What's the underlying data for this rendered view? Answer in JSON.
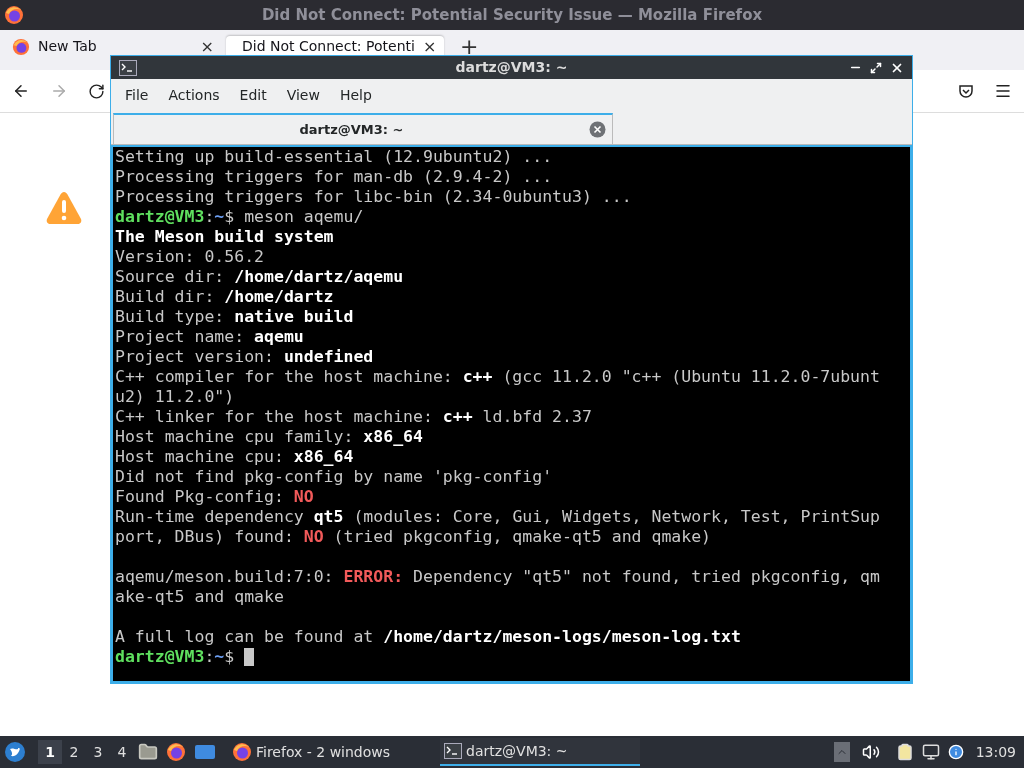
{
  "firefox": {
    "title": "Did Not Connect: Potential Security Issue — Mozilla Firefox",
    "tabs": [
      {
        "label": "New Tab",
        "selected": false,
        "close": "×"
      },
      {
        "label": "Did Not Connect: Potenti",
        "selected": true,
        "close": "×"
      }
    ],
    "new_tab": "+"
  },
  "terminal": {
    "title": "dartz@VM3: ~",
    "menu": [
      "File",
      "Actions",
      "Edit",
      "View",
      "Help"
    ],
    "tabs": [
      {
        "label": "dartz@VM3: ~",
        "selected": true
      }
    ],
    "lines": [
      {
        "kind": "text",
        "segments": [
          {
            "t": "Setting up build-essential (12.9ubuntu2) ...",
            "kind": "plain"
          }
        ]
      },
      {
        "kind": "text",
        "segments": [
          {
            "t": "Processing triggers for man-db (2.9.4-2) ...",
            "kind": "plain"
          }
        ]
      },
      {
        "kind": "text",
        "segments": [
          {
            "t": "Processing triggers for libc-bin (2.34-0ubuntu3) ...",
            "kind": "plain"
          }
        ]
      },
      {
        "kind": "text",
        "segments": [
          {
            "t": "dartz@VM3",
            "kind": "user"
          },
          {
            "t": ":",
            "kind": "plain"
          },
          {
            "t": "~",
            "kind": "path"
          },
          {
            "t": "$ meson aqemu/",
            "kind": "plain"
          }
        ]
      },
      {
        "kind": "text",
        "segments": [
          {
            "t": "The Meson build system",
            "kind": "bold"
          }
        ]
      },
      {
        "kind": "text",
        "segments": [
          {
            "t": "Version: 0.56.2",
            "kind": "plain"
          }
        ]
      },
      {
        "kind": "text",
        "segments": [
          {
            "t": "Source dir: ",
            "kind": "plain"
          },
          {
            "t": "/home/dartz/aqemu",
            "kind": "bold"
          }
        ]
      },
      {
        "kind": "text",
        "segments": [
          {
            "t": "Build dir: ",
            "kind": "plain"
          },
          {
            "t": "/home/dartz",
            "kind": "bold"
          }
        ]
      },
      {
        "kind": "text",
        "segments": [
          {
            "t": "Build type: ",
            "kind": "plain"
          },
          {
            "t": "native build",
            "kind": "bold"
          }
        ]
      },
      {
        "kind": "text",
        "segments": [
          {
            "t": "Project name: ",
            "kind": "plain"
          },
          {
            "t": "aqemu",
            "kind": "bold"
          }
        ]
      },
      {
        "kind": "text",
        "segments": [
          {
            "t": "Project version: ",
            "kind": "plain"
          },
          {
            "t": "undefined",
            "kind": "bold"
          }
        ]
      },
      {
        "kind": "text",
        "segments": [
          {
            "t": "C++ compiler for the host machine: ",
            "kind": "plain"
          },
          {
            "t": "c++",
            "kind": "bold"
          },
          {
            "t": " (gcc 11.2.0 \"c++ (Ubuntu 11.2.0-7ubunt",
            "kind": "plain"
          }
        ]
      },
      {
        "kind": "text",
        "segments": [
          {
            "t": "u2) 11.2.0\")",
            "kind": "plain"
          }
        ]
      },
      {
        "kind": "text",
        "segments": [
          {
            "t": "C++ linker for the host machine: ",
            "kind": "plain"
          },
          {
            "t": "c++",
            "kind": "bold"
          },
          {
            "t": " ld.bfd 2.37",
            "kind": "plain"
          }
        ]
      },
      {
        "kind": "text",
        "segments": [
          {
            "t": "Host machine cpu family: ",
            "kind": "plain"
          },
          {
            "t": "x86_64",
            "kind": "bold"
          }
        ]
      },
      {
        "kind": "text",
        "segments": [
          {
            "t": "Host machine cpu: ",
            "kind": "plain"
          },
          {
            "t": "x86_64",
            "kind": "bold"
          }
        ]
      },
      {
        "kind": "text",
        "segments": [
          {
            "t": "Did not find pkg-config by name 'pkg-config'",
            "kind": "plain"
          }
        ]
      },
      {
        "kind": "text",
        "segments": [
          {
            "t": "Found Pkg-config: ",
            "kind": "plain"
          },
          {
            "t": "NO",
            "kind": "error"
          }
        ]
      },
      {
        "kind": "text",
        "segments": [
          {
            "t": "Run-time dependency ",
            "kind": "plain"
          },
          {
            "t": "qt5",
            "kind": "bold"
          },
          {
            "t": " (modules: Core, Gui, Widgets, Network, Test, PrintSup",
            "kind": "plain"
          }
        ]
      },
      {
        "kind": "text",
        "segments": [
          {
            "t": "port, DBus) found: ",
            "kind": "plain"
          },
          {
            "t": "NO",
            "kind": "error"
          },
          {
            "t": " (tried pkgconfig, qmake-qt5 and qmake)",
            "kind": "plain"
          }
        ]
      },
      {
        "kind": "blank"
      },
      {
        "kind": "text",
        "segments": [
          {
            "t": "aqemu/meson.build:7:0: ",
            "kind": "plain"
          },
          {
            "t": "ERROR:",
            "kind": "error"
          },
          {
            "t": " Dependency \"qt5\" not found, tried pkgconfig, qm",
            "kind": "plain"
          }
        ]
      },
      {
        "kind": "text",
        "segments": [
          {
            "t": "ake-qt5 and qmake",
            "kind": "plain"
          }
        ]
      },
      {
        "kind": "blank"
      },
      {
        "kind": "text",
        "segments": [
          {
            "t": "A full log can be found at ",
            "kind": "plain"
          },
          {
            "t": "/home/dartz/meson-logs/meson-log.txt",
            "kind": "bold"
          }
        ]
      },
      {
        "kind": "prompt",
        "segments": [
          {
            "t": "dartz@VM3",
            "kind": "user"
          },
          {
            "t": ":",
            "kind": "plain"
          },
          {
            "t": "~",
            "kind": "path"
          },
          {
            "t": "$ ",
            "kind": "plain"
          }
        ]
      }
    ]
  },
  "taskbar": {
    "workspaces": [
      {
        "label": "1",
        "selected": true
      },
      {
        "label": "2",
        "selected": false
      },
      {
        "label": "3",
        "selected": false
      },
      {
        "label": "4",
        "selected": false
      }
    ],
    "tasks": [
      {
        "label": "Firefox - 2 windows",
        "selected": false,
        "kind": "browser"
      },
      {
        "label": "dartz@VM3: ~",
        "selected": true,
        "kind": "terminal"
      }
    ],
    "clock": "13:09"
  }
}
